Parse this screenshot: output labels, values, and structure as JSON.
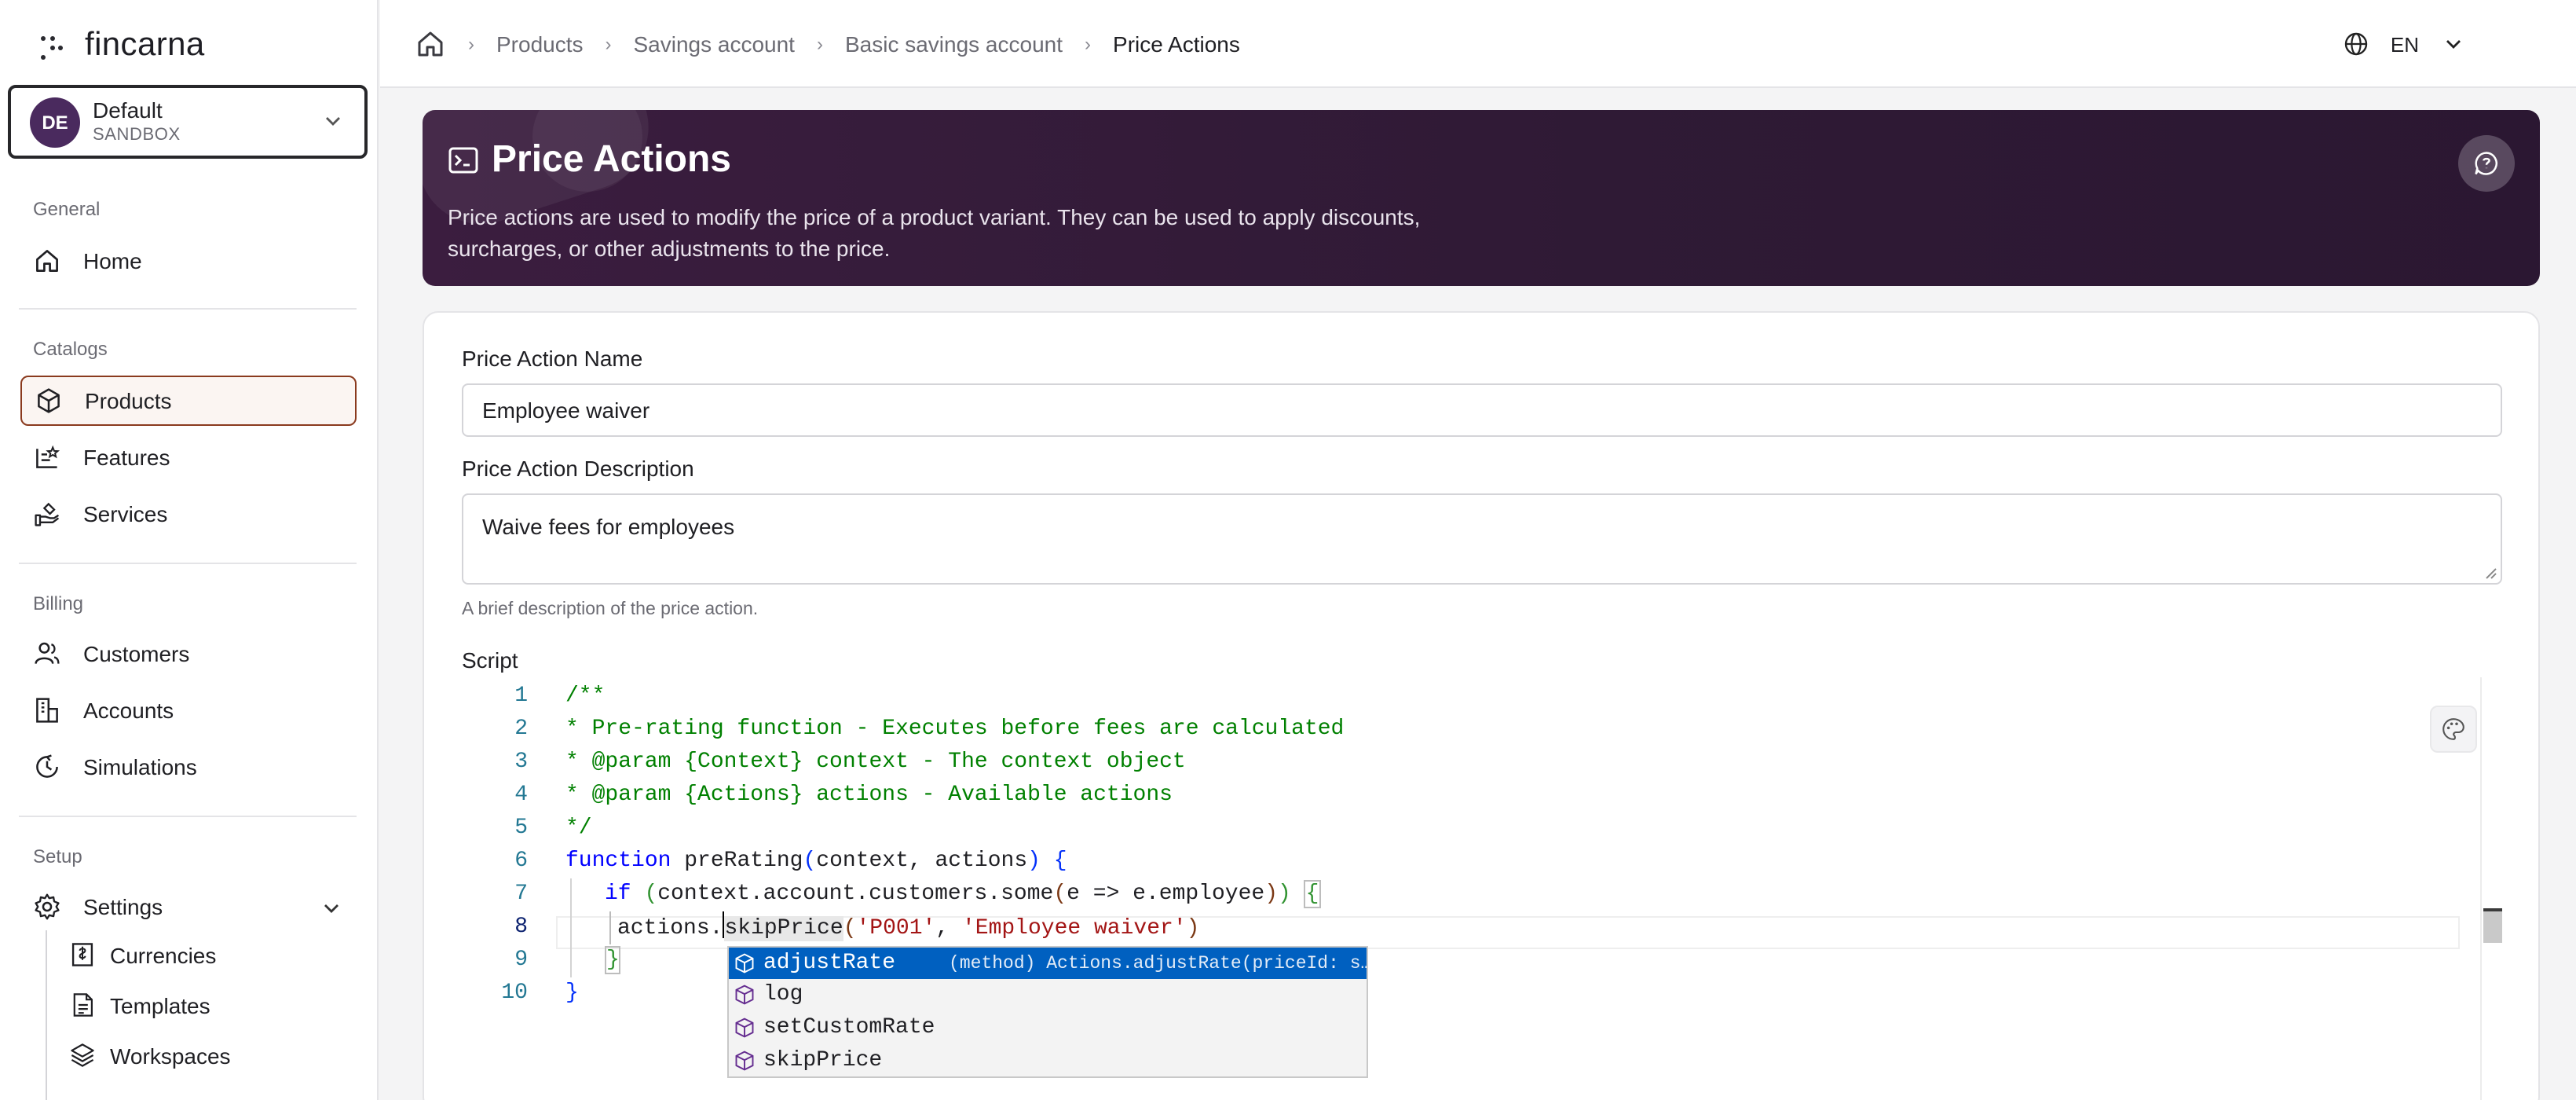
{
  "app": {
    "name": "fincarna"
  },
  "workspace": {
    "initials": "DE",
    "name": "Default",
    "env": "SANDBOX"
  },
  "sidebar": {
    "sections": [
      {
        "label": "General"
      },
      {
        "label": "Catalogs"
      },
      {
        "label": "Billing"
      },
      {
        "label": "Setup"
      }
    ],
    "items": {
      "home": "Home",
      "products": "Products",
      "features": "Features",
      "services": "Services",
      "customers": "Customers",
      "accounts": "Accounts",
      "simulations": "Simulations",
      "settings": "Settings",
      "currencies": "Currencies",
      "templates": "Templates",
      "workspaces": "Workspaces"
    }
  },
  "breadcrumb": [
    "Products",
    "Savings account",
    "Basic savings account",
    "Price Actions"
  ],
  "language": "EN",
  "hero": {
    "title": "Price Actions",
    "description": "Price actions are used to modify the price of a product variant. They can be used to apply discounts, surcharges, or other adjustments to the price."
  },
  "form": {
    "name_label": "Price Action Name",
    "name_value": "Employee waiver",
    "desc_label": "Price Action Description",
    "desc_value": "Waive fees for employees",
    "desc_hint": "A brief description of the price action.",
    "script_label": "Script"
  },
  "editor": {
    "line_numbers": [
      "1",
      "2",
      "3",
      "4",
      "5",
      "6",
      "7",
      "8",
      "9",
      "10"
    ],
    "lines": {
      "l1": "/**",
      "l2": "* Pre-rating function - Executes before fees are calculated",
      "l3": "* @param {Context} context - The context object",
      "l4": "* @param {Actions} actions - Available actions",
      "l5": "*/",
      "l6_kw": "function",
      "l6_name": " preRating",
      "l6_args": "context, actions",
      "l7_kw": "if",
      "l7_a": "context.account.customers.some",
      "l7_b": "e => e.employee",
      "l8_a": "actions.",
      "l8_word": "skipPrice",
      "l8_s1": "'P001'",
      "l8_s2": "'Employee waiver'"
    }
  },
  "suggestions": [
    {
      "label": "adjustRate",
      "detail": "(method) Actions.adjustRate(priceId: s…",
      "selected": true
    },
    {
      "label": "log",
      "detail": "",
      "selected": false
    },
    {
      "label": "setCustomRate",
      "detail": "",
      "selected": false
    },
    {
      "label": "skipPrice",
      "detail": "",
      "selected": false
    }
  ],
  "colors": {
    "accent": "#8a3a1e",
    "hero_bg": "#331a38",
    "suggest_selected": "#0060c0"
  }
}
